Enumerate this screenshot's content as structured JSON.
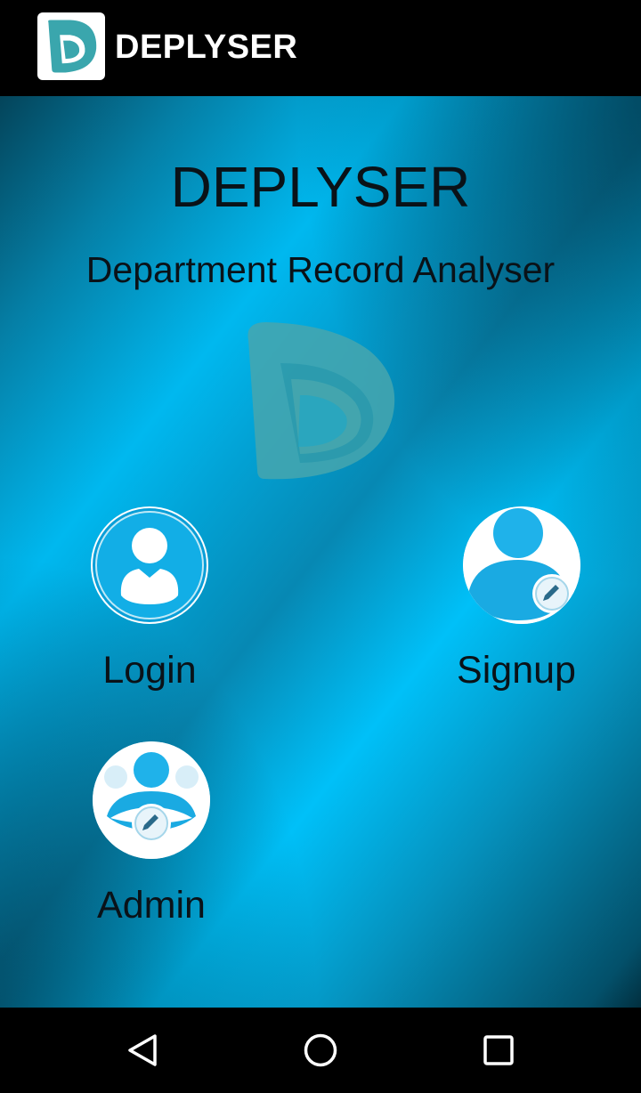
{
  "app_bar": {
    "title": "DEPLYSER",
    "logo_icon": "deplyser-d-logo-icon"
  },
  "hero": {
    "title": "DEPLYSER",
    "subtitle": "Department Record Analyser",
    "watermark_icon": "deplyser-d-logo-icon"
  },
  "roles": {
    "login": {
      "label": "Login",
      "icon": "user-icon"
    },
    "signup": {
      "label": "Signup",
      "icon": "user-edit-icon"
    },
    "admin": {
      "label": "Admin",
      "icon": "admin-group-edit-icon"
    }
  },
  "nav": {
    "back_icon": "back-triangle-icon",
    "home_icon": "home-circle-icon",
    "recents_icon": "recents-square-icon"
  },
  "colors": {
    "accent": "#00b8ef",
    "logo_teal": "#3aa6ad",
    "text_dark": "#0a1218"
  }
}
